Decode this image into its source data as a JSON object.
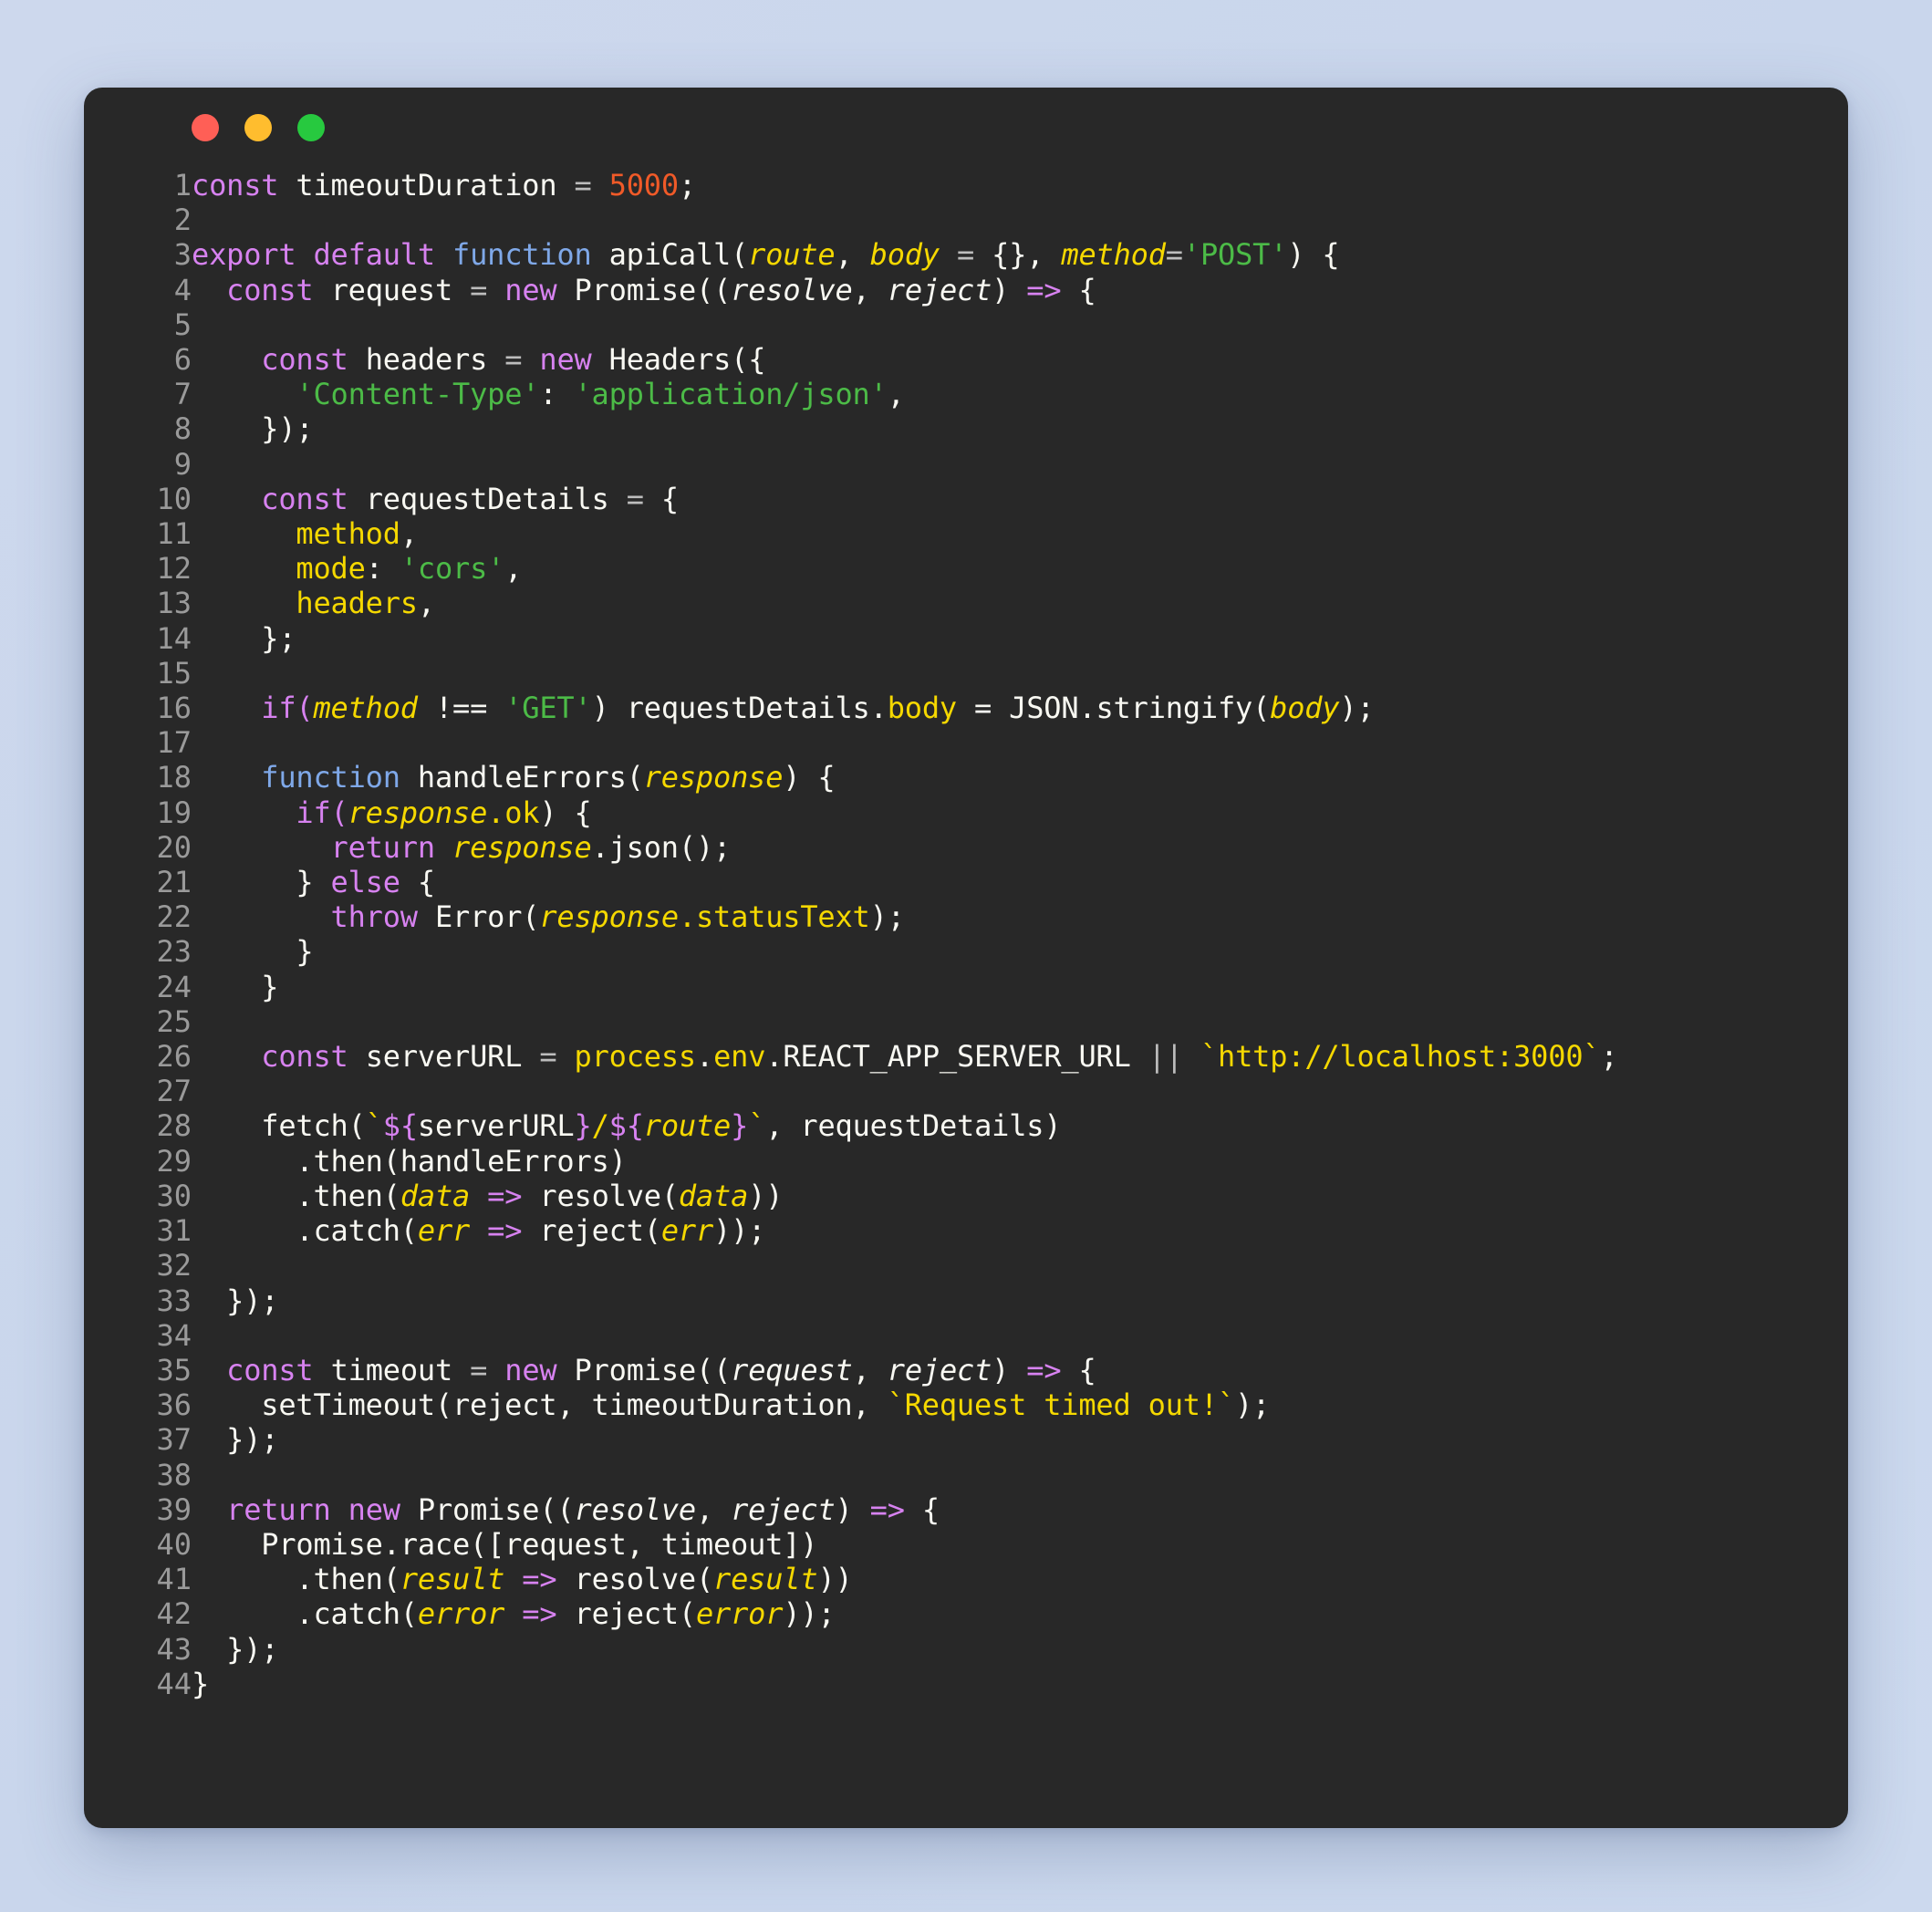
{
  "window": {
    "traffic_lights": [
      {
        "name": "close",
        "color": "#ff5f56"
      },
      {
        "name": "minimize",
        "color": "#ffbd2e"
      },
      {
        "name": "maximize",
        "color": "#27c93f"
      }
    ]
  },
  "editor": {
    "language": "javascript",
    "theme_background": "#282828",
    "page_background": "#ccd8ec",
    "line_count": 44,
    "colors": {
      "keyword": "#d782f0",
      "function": "#7fa8e8",
      "number": "#f05a28",
      "string": "#4cbb47",
      "template_string": "#f5d800",
      "variable": "#f5d800",
      "property": "#f5d800",
      "plain": "#f8f8f2",
      "operator": "#bdbdbd",
      "line_number": "#9a9a9a"
    },
    "line_numbers": [
      "1",
      "2",
      "3",
      "4",
      "5",
      "6",
      "7",
      "8",
      "9",
      "10",
      "11",
      "12",
      "13",
      "14",
      "15",
      "16",
      "17",
      "18",
      "19",
      "20",
      "21",
      "22",
      "23",
      "24",
      "25",
      "26",
      "27",
      "28",
      "29",
      "30",
      "31",
      "32",
      "33",
      "34",
      "35",
      "36",
      "37",
      "38",
      "39",
      "40",
      "41",
      "42",
      "43",
      "44"
    ],
    "lines": [
      "const timeoutDuration = 5000;",
      "",
      "export default function apiCall(route, body = {}, method='POST') {",
      "  const request = new Promise((resolve, reject) => {",
      "",
      "    const headers = new Headers({",
      "      'Content-Type': 'application/json',",
      "    });",
      "",
      "    const requestDetails = {",
      "      method,",
      "      mode: 'cors',",
      "      headers,",
      "    };",
      "",
      "    if(method !== 'GET') requestDetails.body = JSON.stringify(body);",
      "",
      "    function handleErrors(response) {",
      "      if(response.ok) {",
      "        return response.json();",
      "      } else {",
      "        throw Error(response.statusText);",
      "      }",
      "    }",
      "",
      "    const serverURL = process.env.REACT_APP_SERVER_URL || `http://localhost:3000`;",
      "",
      "    fetch(`${serverURL}/${route}`, requestDetails)",
      "      .then(handleErrors)",
      "      .then(data => resolve(data))",
      "      .catch(err => reject(err));",
      "",
      "  });",
      "",
      "  const timeout = new Promise((request, reject) => {",
      "    setTimeout(reject, timeoutDuration, `Request timed out!`);",
      "  });",
      "",
      "  return new Promise((resolve, reject) => {",
      "    Promise.race([request, timeout])",
      "      .then(result => resolve(result))",
      "      .catch(error => reject(error));",
      "  });",
      "}"
    ]
  }
}
